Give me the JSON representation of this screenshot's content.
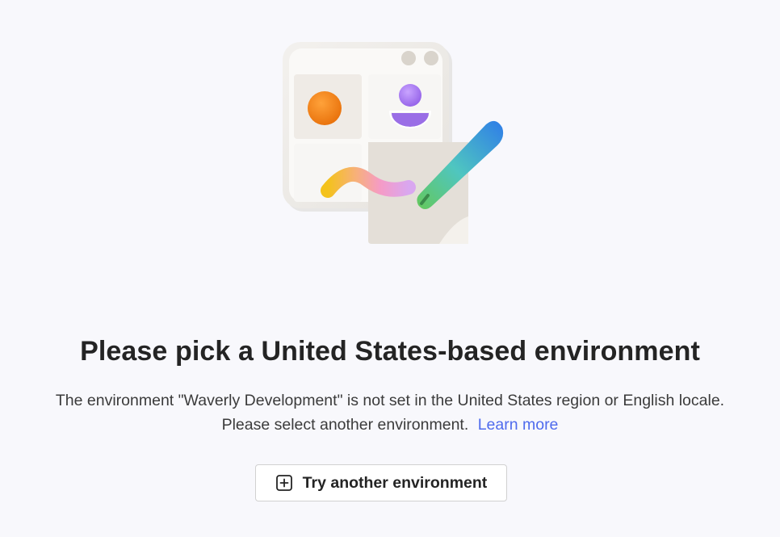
{
  "illustration": {
    "icon": "clay-app-canvas-illustration"
  },
  "headline": "Please pick a United States-based environment",
  "message": {
    "line1": "The environment \"Waverly Development\" is not set in the United States region or English locale.",
    "line2": "Please select another environment.",
    "learn_more": "Learn more"
  },
  "action": {
    "label": "Try another environment",
    "icon": "add-square-icon"
  },
  "colors": {
    "background": "#f8f8fc",
    "accent_link": "#4f6bed",
    "text_primary": "#242424"
  }
}
